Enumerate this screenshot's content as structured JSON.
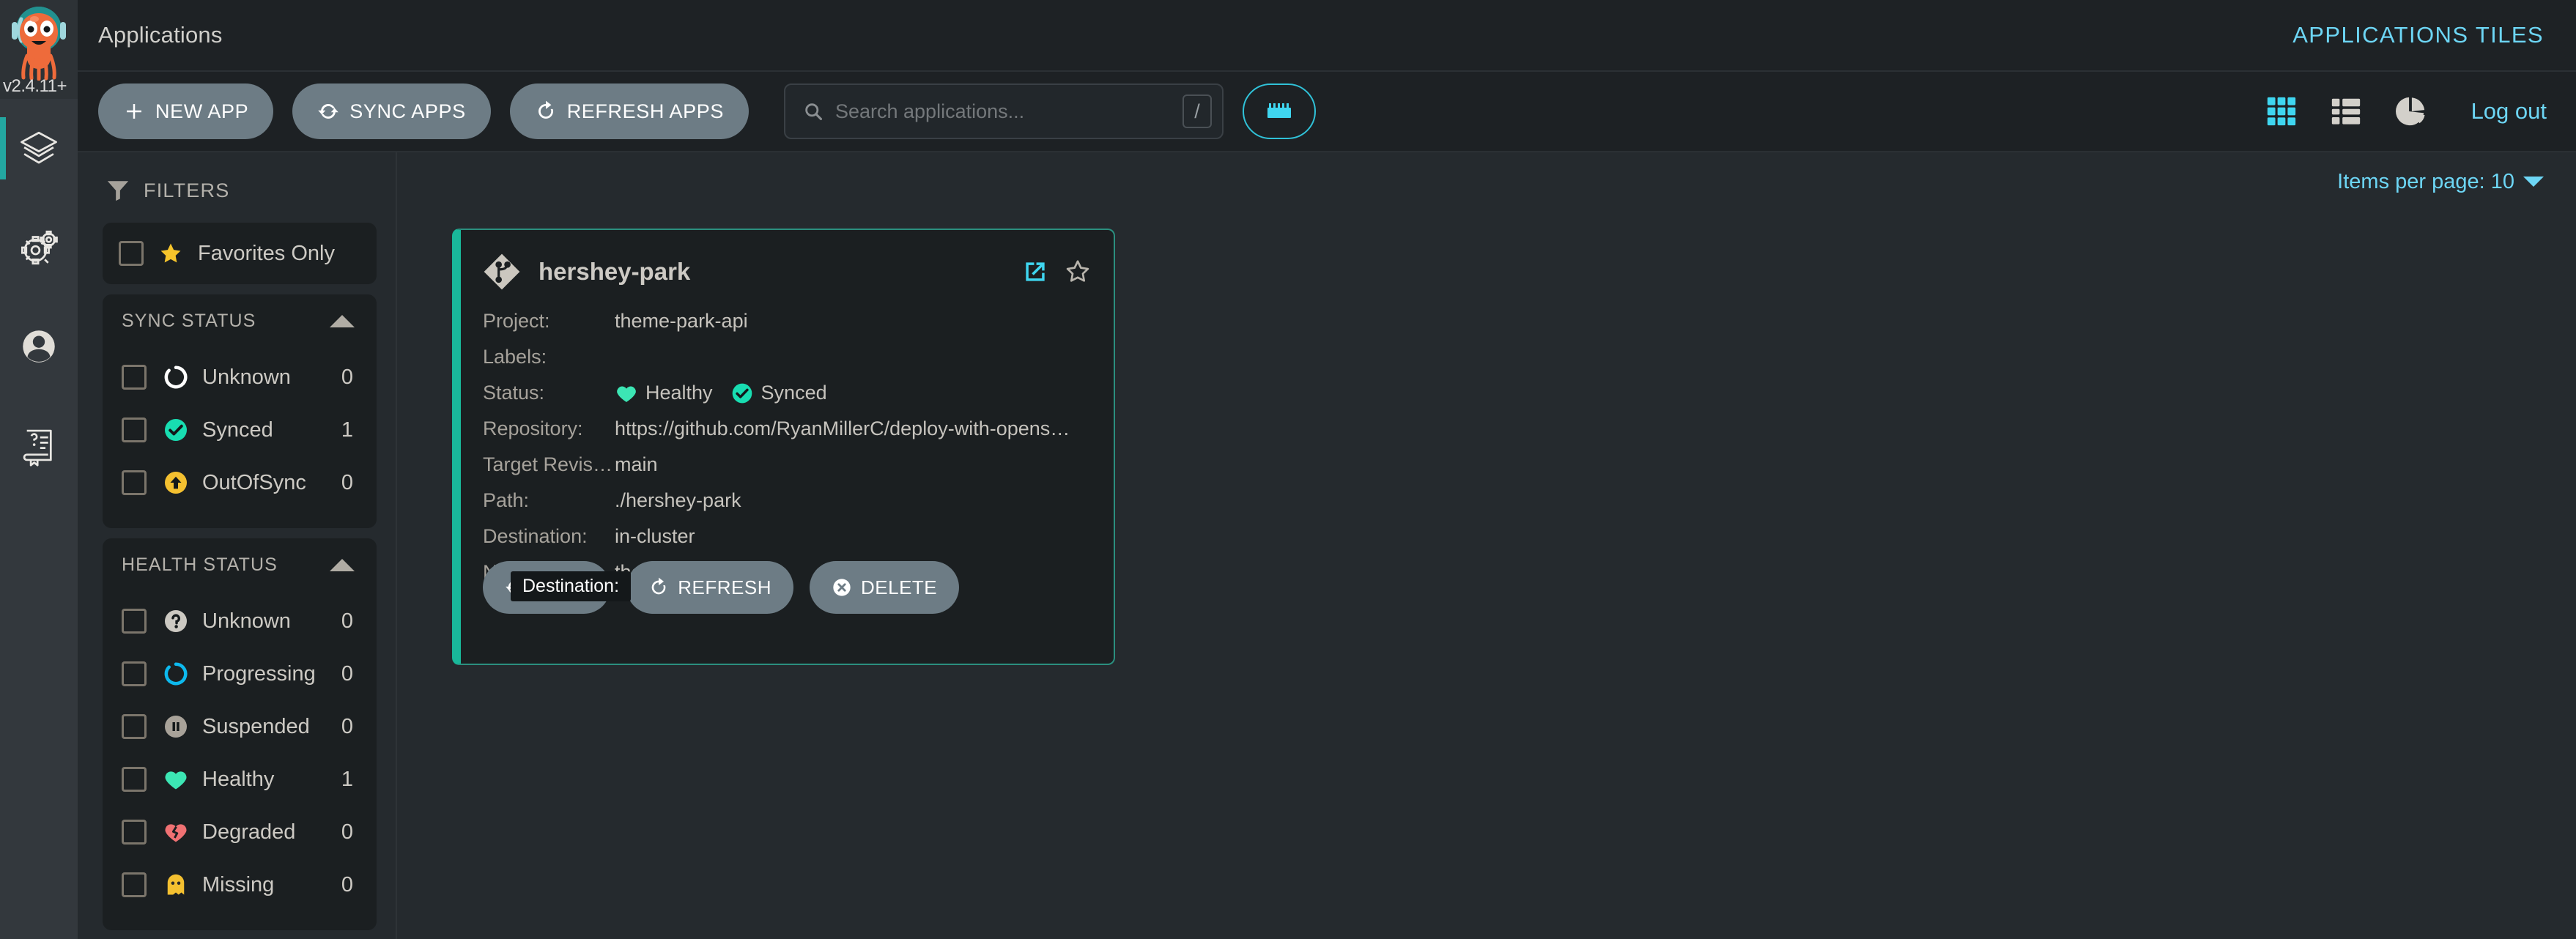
{
  "nav": {
    "version": "v2.4.11+",
    "logo_name": "argo-octopus-logo",
    "items": [
      {
        "name": "applications",
        "icon": "layers-icon",
        "active": true
      },
      {
        "name": "settings",
        "icon": "gears-icon",
        "active": false
      },
      {
        "name": "user-info",
        "icon": "user-avatar-icon",
        "active": false
      },
      {
        "name": "documentation",
        "icon": "help-book-icon",
        "active": false
      }
    ]
  },
  "titlebar": {
    "title": "Applications",
    "right_label": "APPLICATIONS TILES"
  },
  "toolbar": {
    "buttons": [
      {
        "label": "NEW APP",
        "icon": "plus-icon"
      },
      {
        "label": "SYNC APPS",
        "icon": "sync-icon"
      },
      {
        "label": "REFRESH APPS",
        "icon": "refresh-icon"
      }
    ],
    "search": {
      "placeholder": "Search applications...",
      "value": "",
      "shortcut_key": "/"
    },
    "keyboard_button_icon": "keyboard-icon",
    "view_icons": [
      {
        "name": "tiles-view-icon",
        "active": true
      },
      {
        "name": "list-view-icon",
        "active": false
      },
      {
        "name": "summary-pie-view-icon",
        "active": false
      }
    ],
    "logout_label": "Log out"
  },
  "filters": {
    "heading": "FILTERS",
    "favorites": {
      "label": "Favorites Only",
      "checked": false,
      "icon": "star-icon"
    },
    "sections": [
      {
        "title": "SYNC STATUS",
        "collapsed": false,
        "rows": [
          {
            "label": "Unknown",
            "count": "0",
            "icon": "circle-notch-icon",
            "color": "#ffffff",
            "checked": false
          },
          {
            "label": "Synced",
            "count": "1",
            "icon": "check-circle-icon",
            "color": "#18ddb1",
            "checked": false
          },
          {
            "label": "OutOfSync",
            "count": "0",
            "icon": "arrow-circle-up-icon",
            "color": "#f4c030",
            "checked": false
          }
        ]
      },
      {
        "title": "HEALTH STATUS",
        "collapsed": false,
        "rows": [
          {
            "label": "Unknown",
            "count": "0",
            "icon": "question-circle-icon",
            "color": "#ccc9c2",
            "checked": false
          },
          {
            "label": "Progressing",
            "count": "0",
            "icon": "circle-notch-icon",
            "color": "#0db9ee",
            "checked": false
          },
          {
            "label": "Suspended",
            "count": "0",
            "icon": "pause-circle-icon",
            "color": "#a8a299",
            "checked": false
          },
          {
            "label": "Healthy",
            "count": "1",
            "icon": "heart-icon",
            "color": "#3ce6b4",
            "checked": false
          },
          {
            "label": "Degraded",
            "count": "0",
            "icon": "heart-broken-icon",
            "color": "#f07173",
            "checked": false
          },
          {
            "label": "Missing",
            "count": "0",
            "icon": "ghost-icon",
            "color": "#f4c030",
            "checked": false
          }
        ]
      }
    ]
  },
  "apps_pane": {
    "items_per_page_label": "Items per page: 10",
    "tooltip_text": "Destination:",
    "cards": [
      {
        "name": "hershey-park",
        "icon": "git-icon",
        "external_link_icon": "external-link-icon",
        "favorite_icon": "star-outline-icon",
        "rows": [
          {
            "label": "Project:",
            "value": "theme-park-api"
          },
          {
            "label": "Labels:",
            "value": ""
          },
          {
            "label": "Status:",
            "value": ""
          },
          {
            "label": "Repository:",
            "value": "https://github.com/RyanMillerC/deploy-with-opens…"
          },
          {
            "label": "Target Revis…",
            "value": "main"
          },
          {
            "label": "Path:",
            "value": "./hershey-park"
          },
          {
            "label": "Destination:",
            "value": "in-cluster"
          },
          {
            "label": "Namespace:",
            "value": "theme-park-api"
          }
        ],
        "status": {
          "health_label": "Healthy",
          "health_icon": "heart-icon",
          "health_color": "#3ce6b4",
          "sync_label": "Synced",
          "sync_icon": "check-circle-icon",
          "sync_color": "#18ddb1"
        },
        "actions": [
          {
            "label": "SYNC",
            "icon": "sync-icon"
          },
          {
            "label": "REFRESH",
            "icon": "refresh-icon"
          },
          {
            "label": "DELETE",
            "icon": "times-circle-icon"
          }
        ]
      }
    ]
  },
  "colors": {
    "accent_cyan": "#6dd6f5",
    "accent_teal": "#19b89a",
    "bg_dark": "#1b1f21",
    "bg_mid": "#252a2e",
    "bg_rail": "#33383d",
    "btn_grey": "#6d7c85"
  }
}
